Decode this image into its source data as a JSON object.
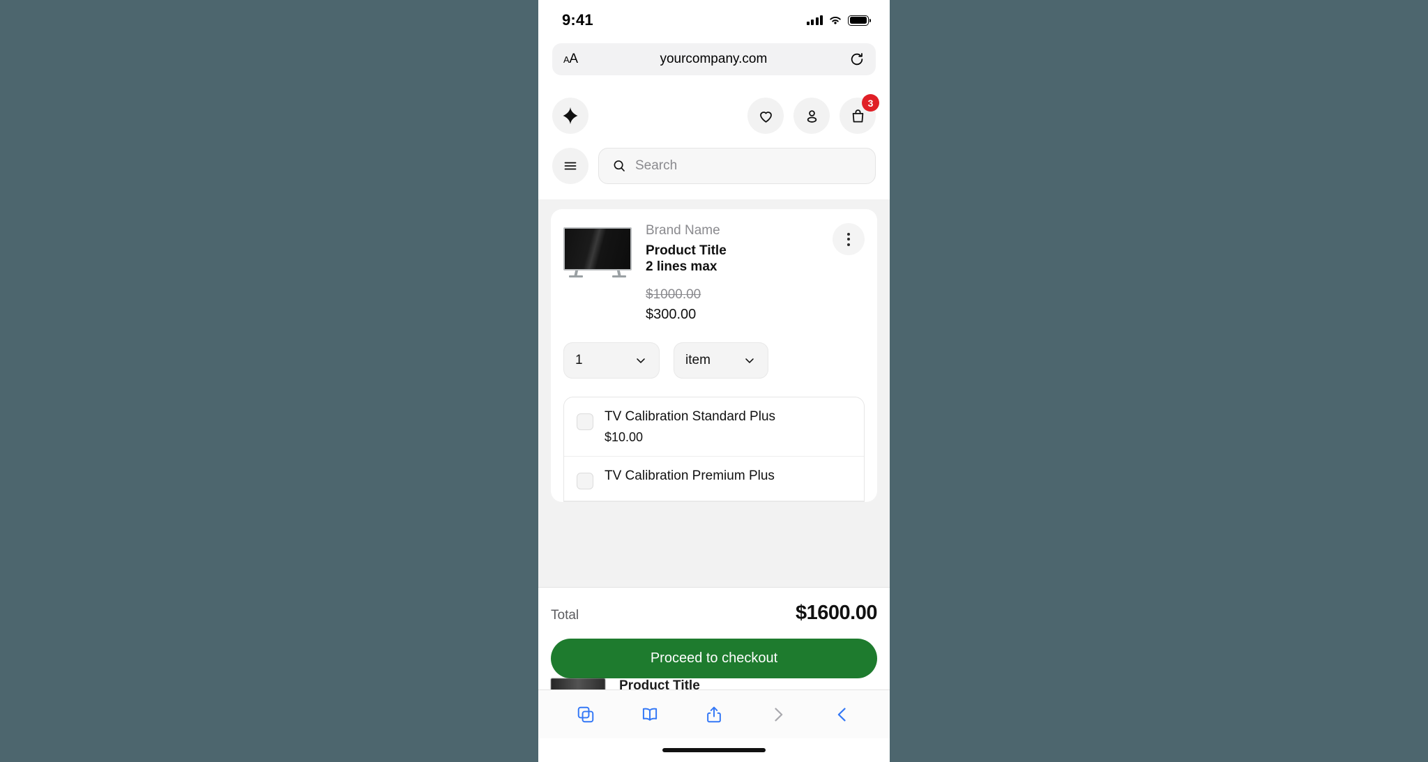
{
  "status_bar": {
    "time": "9:41",
    "icons": [
      "cellular-signal-icon",
      "wifi-icon",
      "battery-icon"
    ]
  },
  "browser": {
    "url": "yourcompany.com",
    "text_size_label": "AA",
    "reload_icon": "reload-icon",
    "toolbar": [
      {
        "name": "tabs-button",
        "icon": "tabs-icon",
        "state": "enabled"
      },
      {
        "name": "bookmarks-button",
        "icon": "book-icon",
        "state": "enabled"
      },
      {
        "name": "share-button",
        "icon": "share-icon",
        "state": "enabled"
      },
      {
        "name": "forward-button",
        "icon": "chevron-right-icon",
        "state": "disabled"
      },
      {
        "name": "back-button",
        "icon": "chevron-left-icon",
        "state": "enabled"
      }
    ]
  },
  "site_header": {
    "logo_icon": "sparkle-icon",
    "actions": [
      {
        "name": "wishlist-button",
        "icon": "heart-icon"
      },
      {
        "name": "account-button",
        "icon": "person-icon"
      },
      {
        "name": "cart-button",
        "icon": "shopping-bag-icon",
        "badge": "3"
      }
    ],
    "menu_icon": "hamburger-menu-icon",
    "search": {
      "placeholder": "Search",
      "value": "",
      "icon": "search-icon"
    }
  },
  "cart": {
    "product": {
      "brand": "Brand Name",
      "title_line1": "Product Title",
      "title_line2": "2 lines max",
      "price_original": "$1000.00",
      "price_current": "$300.00",
      "thumbnail": "television-image",
      "overflow_icon": "kebab-menu-icon"
    },
    "quantity_select": {
      "value": "1",
      "chevron": "chevron-down-icon"
    },
    "unit_select": {
      "value": "item",
      "chevron": "chevron-down-icon"
    },
    "addons": [
      {
        "name": "TV Calibration Standard Plus",
        "price": "$10.00",
        "checked": false
      },
      {
        "name": "TV Calibration Premium Plus",
        "price": "",
        "checked": false
      }
    ],
    "next_item_title": "Product Title"
  },
  "footer": {
    "total_label": "Total",
    "total_value": "$1600.00",
    "checkout_label": "Proceed to checkout",
    "checkout_color": "#1E7B2E"
  },
  "colors": {
    "backdrop": "#4D666E",
    "page_bg": "#F2F2F2",
    "badge": "#E01F26",
    "accent_blue": "#3478F6"
  }
}
